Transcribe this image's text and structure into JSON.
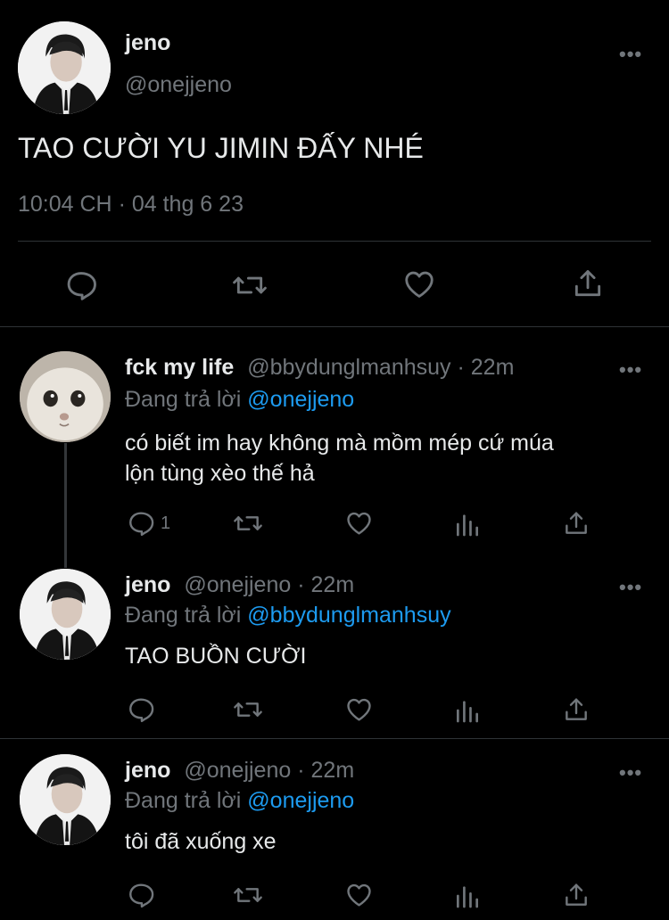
{
  "main_tweet": {
    "display_name": "jeno",
    "handle": "@onejjeno",
    "text": "TAO CƯỜI YU JIMIN ĐẤY NHÉ",
    "time": "10:04 CH",
    "separator": "·",
    "date": "04 thg 6 23",
    "more": "•••"
  },
  "replies": [
    {
      "display_name": "fck my life",
      "handle": "@bbydunglmanhsuy",
      "dot": "·",
      "age": "22m",
      "replying_label": "Đang trả lời",
      "replying_to": "@onejjeno",
      "text_line1": "có biết im hay không mà mồm mép cứ múa",
      "text_line2": "lộn tùng xèo thế hả",
      "reply_count": "1",
      "more": "•••"
    },
    {
      "display_name": "jeno",
      "handle": "@onejjeno",
      "dot": "·",
      "age": "22m",
      "replying_label": "Đang trả lời",
      "replying_to": "@bbydunglmanhsuy",
      "text": "TAO BUỒN CƯỜI",
      "more": "•••"
    },
    {
      "display_name": "jeno",
      "handle": "@onejjeno",
      "dot": "·",
      "age": "22m",
      "replying_label": "Đang trả lời",
      "replying_to": "@onejjeno",
      "text": "tôi đã xuống xe",
      "more": "•••"
    }
  ],
  "colors": {
    "background": "#000000",
    "text": "#e7e9ea",
    "muted": "#71767b",
    "link": "#1d9bf0",
    "divider": "#2f3336"
  }
}
